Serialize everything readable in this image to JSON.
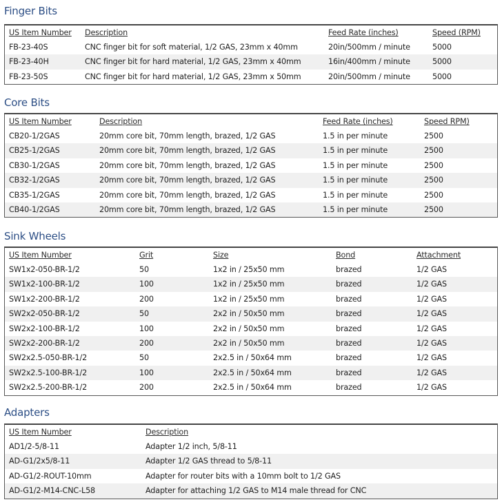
{
  "sections": [
    {
      "title": "Finger Bits",
      "columns": [
        "US Item Number",
        "Description",
        "Feed Rate (inches)",
        "Speed (RPM)"
      ],
      "rows": [
        [
          "FB-23-40S",
          "CNC finger bit for soft material, 1/2 GAS, 23mm x 40mm",
          "20in/500mm / minute",
          "5000"
        ],
        [
          "FB-23-40H",
          "CNC finger bit for hard material, 1/2 GAS, 23mm x 40mm",
          "16in/400mm / minute",
          "5000"
        ],
        [
          "FB-23-50S",
          "CNC finger bit for hard material, 1/2 GAS, 23mm x 50mm",
          "20in/500mm / minute",
          "5000"
        ]
      ]
    },
    {
      "title": "Core Bits",
      "columns": [
        "US Item Number",
        "Description",
        "Feed Rate (inches)",
        "Speed RPM)"
      ],
      "rows": [
        [
          "CB20-1/2GAS",
          "20mm core bit, 70mm length, brazed, 1/2 GAS",
          "1.5 in per minute",
          "2500"
        ],
        [
          "CB25-1/2GAS",
          "20mm core bit, 70mm length, brazed, 1/2 GAS",
          "1.5 in per minute",
          "2500"
        ],
        [
          "CB30-1/2GAS",
          "20mm core bit, 70mm length, brazed, 1/2 GAS",
          "1.5 in per minute",
          "2500"
        ],
        [
          "CB32-1/2GAS",
          "20mm core bit, 70mm length, brazed, 1/2 GAS",
          "1.5 in per minute",
          "2500"
        ],
        [
          "CB35-1/2GAS",
          "20mm core bit, 70mm length, brazed, 1/2 GAS",
          "1.5 in per minute",
          "2500"
        ],
        [
          "CB40-1/2GAS",
          "20mm core bit, 70mm length, brazed, 1/2 GAS",
          "1.5 in per minute",
          "2500"
        ]
      ]
    },
    {
      "title": "Sink Wheels",
      "columns": [
        "US Item Number",
        "Grit",
        "Size",
        "Bond",
        "Attachment"
      ],
      "rows": [
        [
          "SW1x2-050-BR-1/2",
          "50",
          "1x2 in / 25x50 mm",
          "brazed",
          "1/2 GAS"
        ],
        [
          "SW1x2-100-BR-1/2",
          "100",
          "1x2 in / 25x50 mm",
          "brazed",
          "1/2 GAS"
        ],
        [
          "SW1x2-200-BR-1/2",
          "200",
          "1x2 in / 25x50 mm",
          "brazed",
          "1/2 GAS"
        ],
        [
          "SW2x2-050-BR-1/2",
          "50",
          "2x2 in / 50x50 mm",
          "brazed",
          "1/2 GAS"
        ],
        [
          "SW2x2-100-BR-1/2",
          "100",
          "2x2 in / 50x50 mm",
          "brazed",
          "1/2 GAS"
        ],
        [
          "SW2x2-200-BR-1/2",
          "200",
          "2x2 in / 50x50 mm",
          "brazed",
          "1/2 GAS"
        ],
        [
          "SW2x2.5-050-BR-1/2",
          "50",
          "2x2.5 in / 50x64 mm",
          "brazed",
          "1/2 GAS"
        ],
        [
          "SW2x2.5-100-BR-1/2",
          "100",
          "2x2.5 in / 50x64 mm",
          "brazed",
          "1/2 GAS"
        ],
        [
          "SW2x2.5-200-BR-1/2",
          "200",
          "2x2.5 in / 50x64 mm",
          "brazed",
          "1/2 GAS"
        ]
      ]
    },
    {
      "title": "Adapters",
      "columns": [
        "US Item Number",
        "Description"
      ],
      "rows": [
        [
          "AD1/2-5/8-11",
          "Adapter 1/2 inch, 5/8-11"
        ],
        [
          "AD-G1/2x5/8-11",
          "Adapter 1/2 GAS thread to 5/8-11"
        ],
        [
          "AD-G1/2-ROUT-10mm",
          "Adapter for router bits with a 10mm bolt to 1/2 GAS"
        ],
        [
          "AD-G1/2-M14-CNC-L58",
          "Adapter for attaching 1/2 GAS to M14 male thread for CNC"
        ]
      ]
    }
  ]
}
